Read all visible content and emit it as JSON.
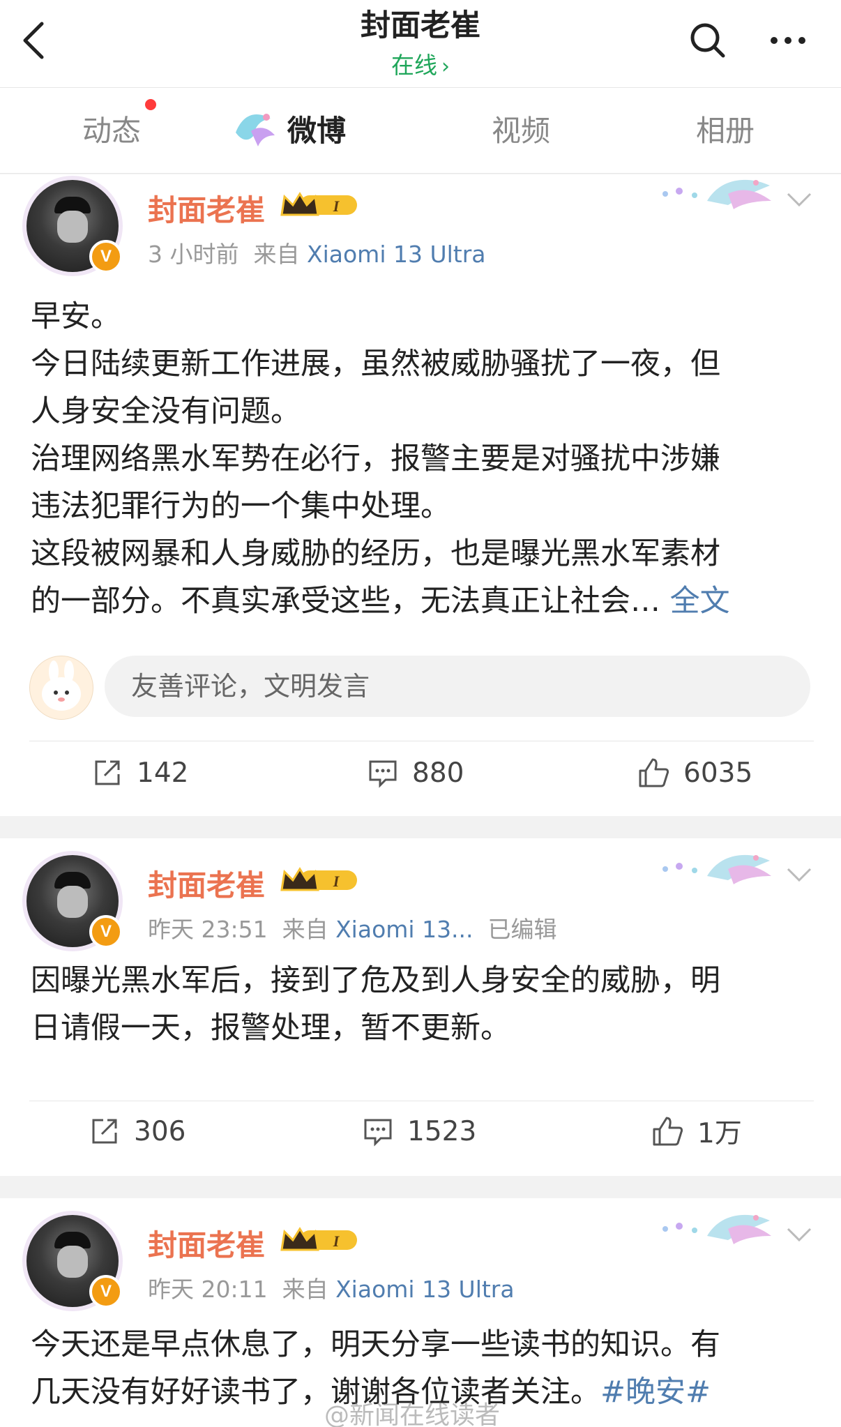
{
  "header": {
    "title": "封面老崔",
    "status": "在线",
    "status_chevron": "›",
    "icons": [
      "back-arrow-icon",
      "search-icon",
      "more-icon"
    ]
  },
  "tabs": [
    {
      "label": "动态",
      "has_red_dot": true
    },
    {
      "label": "微博",
      "active": true,
      "icon": "weibo-bird-icon"
    },
    {
      "label": "视频"
    },
    {
      "label": "相册"
    }
  ],
  "posts": [
    {
      "author": "封面老崔",
      "level_badge": "I",
      "time": "3 小时前",
      "source_prefix": "来自",
      "source": "Xiaomi 13 Ultra",
      "text_lines": [
        "早安。",
        "今日陆续更新工作进展，虽然被威胁骚扰了一夜，但",
        "人身安全没有问题。",
        "治理网络黑水军势在必行，报警主要是对骚扰中涉嫌",
        "违法犯罪行为的一个集中处理。",
        "这段被网暴和人身威胁的经历，也是曝光黑水军素材",
        "的一部分。不真实承受这些，无法真正让社会…"
      ],
      "more_label": "全文",
      "comment_placeholder": "友善评论，文明发言",
      "reposts": "142",
      "comments": "880",
      "likes": "6035"
    },
    {
      "author": "封面老崔",
      "level_badge": "I",
      "time": "昨天 23:51",
      "source_prefix": "来自",
      "source": "Xiaomi 13...",
      "edited": "已编辑",
      "text_lines": [
        "因曝光黑水军后，接到了危及到人身安全的威胁，明",
        "日请假一天，报警处理，暂不更新。"
      ],
      "reposts": "306",
      "comments": "1523",
      "likes": "1万"
    },
    {
      "author": "封面老崔",
      "level_badge": "I",
      "time": "昨天 20:11",
      "source_prefix": "来自",
      "source": "Xiaomi 13 Ultra",
      "text_lines": [
        "今天还是早点休息了，明天分享一些读书的知识。有",
        "几天没有好好读书了，谢谢各位读者关注。"
      ],
      "hashtag": "#晚安#"
    }
  ],
  "watermark": "@新闻在线读者",
  "colors": {
    "username": "#eb7350",
    "link": "#507daf",
    "online": "#1fa65a",
    "red_dot": "#ff3b3b",
    "verified_badge": "#f39c12"
  }
}
